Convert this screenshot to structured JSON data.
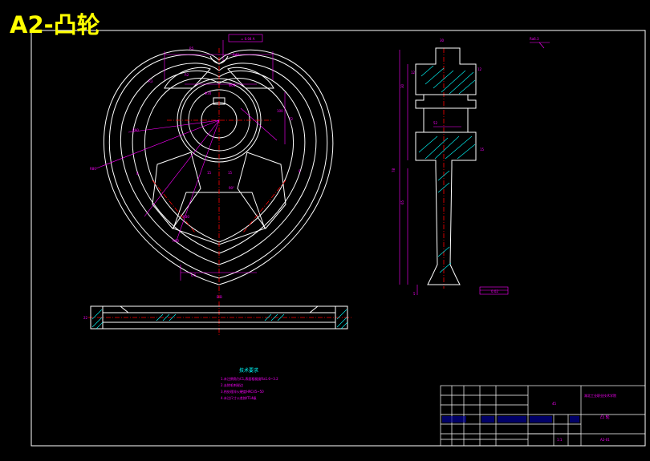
{
  "title": "A2-凸轮",
  "tech_req": {
    "heading": "技术要求",
    "lines": [
      "1.未注倒角为C1,表面粗糙度Ra1.6~3.2",
      "2.去除毛刺锐边",
      "3.热处理淬火硬度HRC45~50",
      "4.未注尺寸公差按IT14级"
    ]
  },
  "title_block": {
    "org": "湖北工业职业技术学院",
    "part": "凸 轮",
    "scale": "1:1",
    "material": "45",
    "drawing_no": "A2-01"
  },
  "datum_labels": [
    "A",
    "B"
  ],
  "colors": {
    "background": "#000000",
    "line": "#ffffff",
    "dimension": "#ff00ff",
    "center": "#ff0000",
    "hatch": "#00ffff",
    "text": "#ffff00"
  }
}
